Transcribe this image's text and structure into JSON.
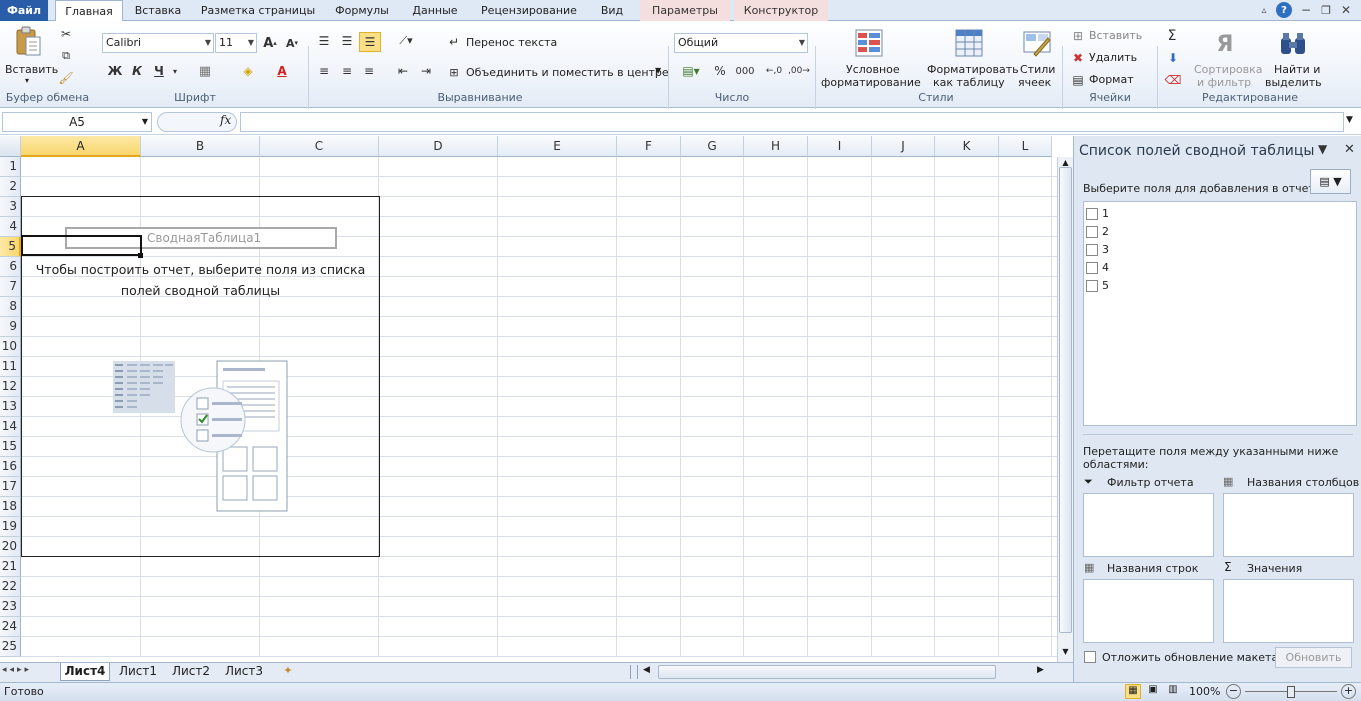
{
  "ribbon_tabs": {
    "file": "Файл",
    "home": "Главная",
    "insert": "Вставка",
    "page_layout": "Разметка страницы",
    "formulas": "Формулы",
    "data": "Данные",
    "review": "Рецензирование",
    "view": "Вид",
    "options": "Параметры",
    "design": "Конструктор"
  },
  "clipboard": {
    "paste": "Вставить",
    "group": "Буфер обмена"
  },
  "font": {
    "name": "Calibri",
    "size": "11",
    "bold": "Ж",
    "italic": "К",
    "underline": "Ч",
    "group": "Шрифт"
  },
  "alignment": {
    "wrap": "Перенос текста",
    "merge": "Объединить и поместить в центре",
    "group": "Выравнивание"
  },
  "number": {
    "format": "Общий",
    "percent": "%",
    "thousands": "000",
    "group": "Число"
  },
  "styles": {
    "conditional_1": "Условное",
    "conditional_2": "форматирование",
    "format_table_1": "Форматировать",
    "format_table_2": "как таблицу",
    "cell_styles_1": "Стили",
    "cell_styles_2": "ячеек",
    "group": "Стили"
  },
  "cells": {
    "insert": "Вставить",
    "delete": "Удалить",
    "format": "Формат",
    "group": "Ячейки"
  },
  "editing": {
    "sigma": "Σ",
    "sort_1": "Сортировка",
    "sort_2": "и фильтр",
    "find_1": "Найти и",
    "find_2": "выделить",
    "group": "Редактирование"
  },
  "formula_bar": {
    "name_box": "A5",
    "fx": "fx",
    "formula": ""
  },
  "columns": [
    "A",
    "B",
    "C",
    "D",
    "E",
    "F",
    "G",
    "H",
    "I",
    "J",
    "K",
    "L"
  ],
  "rows": [
    "1",
    "2",
    "3",
    "4",
    "5",
    "6",
    "7",
    "8",
    "9",
    "10",
    "11",
    "12",
    "13",
    "14",
    "15",
    "16",
    "17",
    "18",
    "19",
    "20",
    "21",
    "22",
    "23",
    "24",
    "25"
  ],
  "pivot": {
    "name": "СводнаяТаблица1",
    "hint_line1": "Чтобы построить отчет, выберите поля из списка",
    "hint_line2": "полей сводной таблицы"
  },
  "sheet_tabs": [
    "Лист4",
    "Лист1",
    "Лист2",
    "Лист3"
  ],
  "status": {
    "ready": "Готово",
    "zoom": "100%"
  },
  "field_list": {
    "title": "Список полей сводной таблицы",
    "choose": "Выберите поля для добавления в отчет:",
    "fields": [
      "1",
      "2",
      "3",
      "4",
      "5"
    ],
    "drag_hint_1": "Перетащите поля между указанными ниже",
    "drag_hint_2": "областями:",
    "filter": "Фильтр отчета",
    "col_labels": "Названия столбцов",
    "row_labels": "Названия строк",
    "values": "Значения",
    "defer": "Отложить обновление макета",
    "update": "Обновить"
  },
  "colors": {
    "accent": "#2a5da8",
    "selected_header": "#f9d76e",
    "grid": "#dadfe6",
    "panel": "#dfe8f2"
  }
}
